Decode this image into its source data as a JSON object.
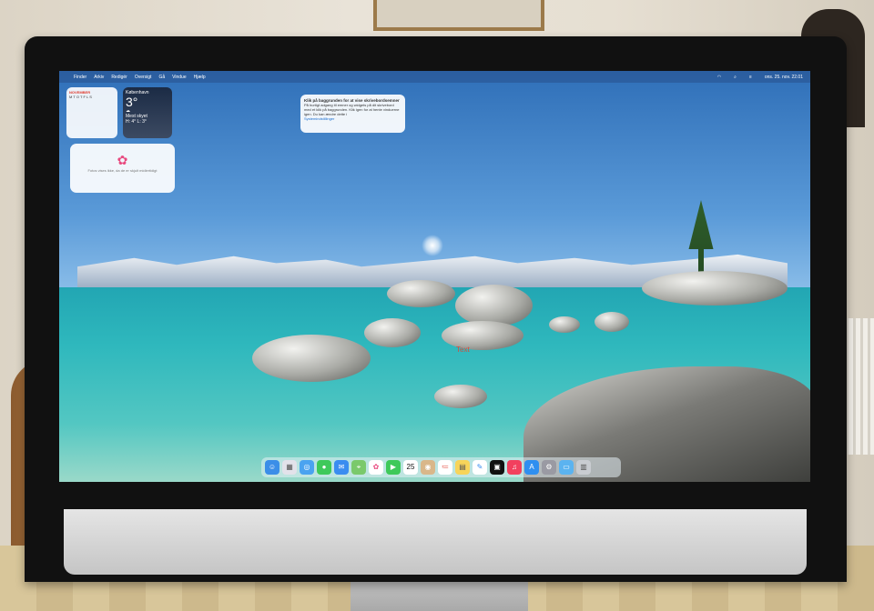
{
  "scene": "iMac on desk showing macOS desktop with Lake Tahoe wallpaper",
  "menubar": {
    "menus": [
      "Finder",
      "Arkiv",
      "Redigér",
      "Oversigt",
      "Gå",
      "Vindue",
      "Hjælp"
    ],
    "clock": "ons. 25. nov. 22.01"
  },
  "widgets": {
    "calendar": {
      "month": "NOVEMBER",
      "days": "M T O T F L S"
    },
    "weather": {
      "city": "København",
      "temp": "3°",
      "condition": "Mest skyet",
      "hilo": "H: 4° L: 3°"
    },
    "photos": {
      "caption": "Fotos vises ikke, da de er skjult midlertidigt"
    }
  },
  "notification": {
    "title": "Klik på baggrunden for at vise skrivebordsemner",
    "body": "På hurtigt adgang til emner og widgets på dit skrivebord med et klik på baggrunden. Klik igen for at hente vinduerne igen. Du kan ændre dette i",
    "link": "Systemindstillinger"
  },
  "desktop_label": "Text",
  "dock": {
    "icons": [
      "finder-icon",
      "launchpad-icon",
      "safari-icon",
      "messages-icon",
      "mail-icon",
      "maps-icon",
      "photos-icon",
      "facetime-icon",
      "calendar-icon",
      "contacts-icon",
      "reminders-icon",
      "notes-icon",
      "freeform-icon",
      "tv-icon",
      "music-icon",
      "appstore-icon",
      "settings-icon",
      "downloads-icon",
      "trash-icon"
    ],
    "calendar_day": "25"
  },
  "colors": {
    "accent": "#1a6fd1",
    "calendar_red": "#e0392b"
  }
}
